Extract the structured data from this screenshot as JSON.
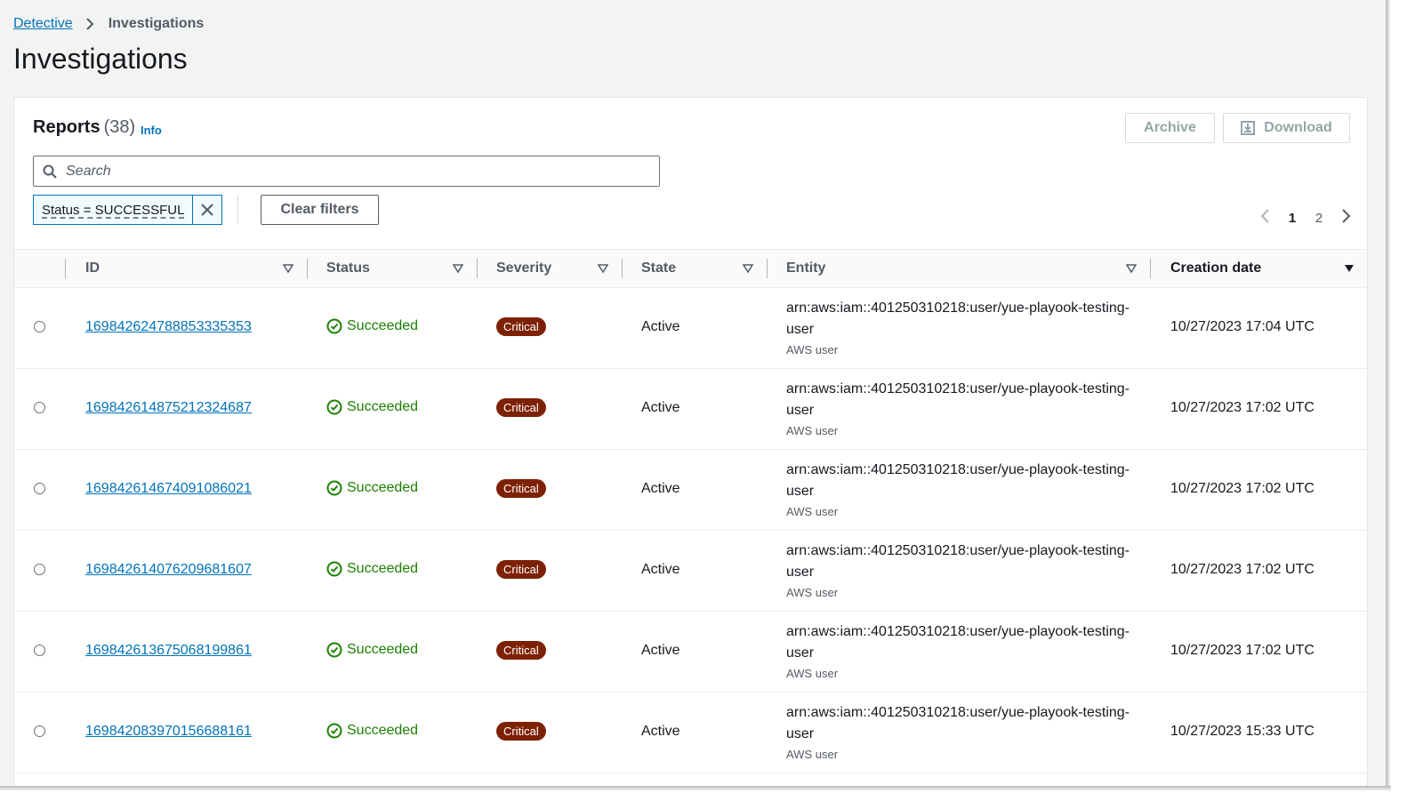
{
  "breadcrumb": {
    "parent": "Detective",
    "current": "Investigations"
  },
  "page_title": "Investigations",
  "panel": {
    "title": "Reports",
    "count": "(38)",
    "info": "Info",
    "archive_label": "Archive",
    "download_label": "Download",
    "search_placeholder": "Search",
    "filter_token": "Status = SUCCESSFUL",
    "clear_filters_label": "Clear filters",
    "pagination": {
      "pages": [
        "1",
        "2"
      ],
      "current": "1"
    }
  },
  "table": {
    "columns": [
      "ID",
      "Status",
      "Severity",
      "State",
      "Entity",
      "Creation date"
    ],
    "rows": [
      {
        "id": "169842624788853335353",
        "status": "Succeeded",
        "severity": "Critical",
        "state": "Active",
        "entity_line1": "arn:aws:iam::401250310218:user/yue-playook-testing-",
        "entity_line2": "user",
        "entity_type": "AWS user",
        "creation_date": "10/27/2023 17:04 UTC"
      },
      {
        "id": "169842614875212324687",
        "status": "Succeeded",
        "severity": "Critical",
        "state": "Active",
        "entity_line1": "arn:aws:iam::401250310218:user/yue-playook-testing-",
        "entity_line2": "user",
        "entity_type": "AWS user",
        "creation_date": "10/27/2023 17:02 UTC"
      },
      {
        "id": "169842614674091086021",
        "status": "Succeeded",
        "severity": "Critical",
        "state": "Active",
        "entity_line1": "arn:aws:iam::401250310218:user/yue-playook-testing-",
        "entity_line2": "user",
        "entity_type": "AWS user",
        "creation_date": "10/27/2023 17:02 UTC"
      },
      {
        "id": "169842614076209681607",
        "status": "Succeeded",
        "severity": "Critical",
        "state": "Active",
        "entity_line1": "arn:aws:iam::401250310218:user/yue-playook-testing-",
        "entity_line2": "user",
        "entity_type": "AWS user",
        "creation_date": "10/27/2023 17:02 UTC"
      },
      {
        "id": "169842613675068199861",
        "status": "Succeeded",
        "severity": "Critical",
        "state": "Active",
        "entity_line1": "arn:aws:iam::401250310218:user/yue-playook-testing-",
        "entity_line2": "user",
        "entity_type": "AWS user",
        "creation_date": "10/27/2023 17:02 UTC"
      },
      {
        "id": "169842083970156688161",
        "status": "Succeeded",
        "severity": "Critical",
        "state": "Active",
        "entity_line1": "arn:aws:iam::401250310218:user/yue-playook-testing-",
        "entity_line2": "user",
        "entity_type": "AWS user",
        "creation_date": "10/27/2023 15:33 UTC"
      }
    ]
  },
  "colors": {
    "link": "#0073bb",
    "success": "#1d8102",
    "critical_badge": "#7d2105",
    "background": "#f2f3f3"
  },
  "icons": {
    "breadcrumb_separator": "chevron-right-icon",
    "search": "search-icon",
    "download": "download-icon",
    "filter_remove": "close-icon",
    "pager_prev": "chevron-left-icon",
    "pager_next": "chevron-right-icon",
    "column_sort": "caret-down-icon",
    "status": "check-circle-icon"
  }
}
